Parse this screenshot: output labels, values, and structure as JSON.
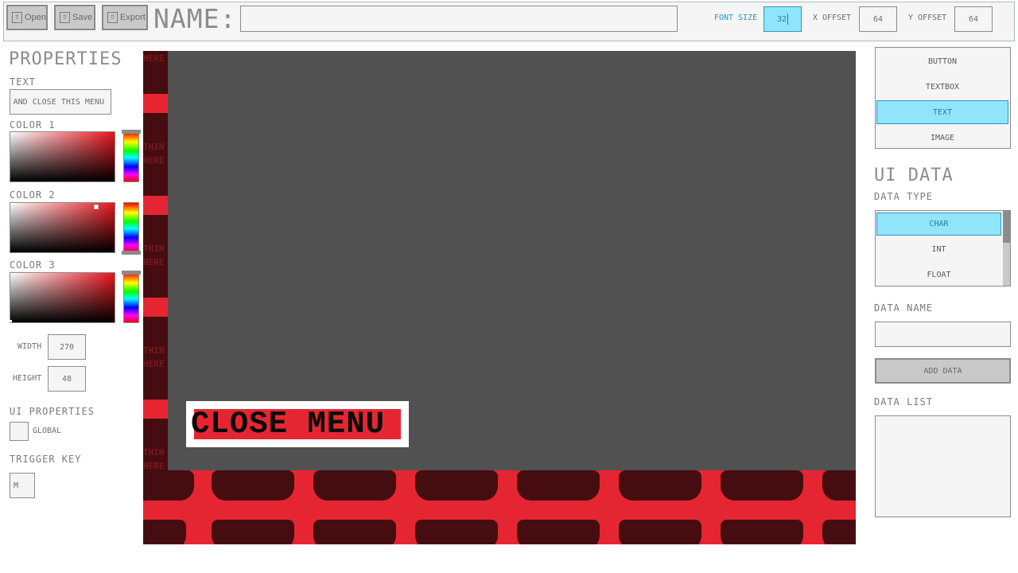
{
  "toolbar": {
    "open_label": "Open",
    "save_label": "Save",
    "export_label": "Export",
    "name_label": "NAME:",
    "name_value": "",
    "font_size_label": "FONT SIZE",
    "font_size_value": "32",
    "x_offset_label": "X OFFSET",
    "x_offset_value": "64",
    "y_offset_label": "Y OFFSET",
    "y_offset_value": "64"
  },
  "properties": {
    "title": "PROPERTIES",
    "text_label": "TEXT",
    "text_value": "AND CLOSE THIS MENU",
    "color1_label": "COLOR 1",
    "color2_label": "COLOR 2",
    "color3_label": "COLOR 3",
    "picker_hue": "#e8141c",
    "width_label": "WIDTH",
    "width_value": "270",
    "height_label": "HEIGHT",
    "height_value": "48",
    "ui_properties_label": "UI PROPERTIES",
    "global_label": "GLOBAL",
    "global_checked": false,
    "trigger_key_label": "TRIGGER KEY",
    "trigger_key_value": "M"
  },
  "canvas": {
    "bg_text_top": "HERE",
    "bg_text_1": "THIN",
    "bg_text_2": "HERE",
    "element_text": "CLOSE MENU",
    "accent_red": "#e52632",
    "dark_red": "#450d10",
    "gray": "#515151"
  },
  "element_types": {
    "items": [
      "BUTTON",
      "TEXTBOX",
      "TEXT",
      "IMAGE"
    ],
    "selected": "TEXT"
  },
  "ui_data": {
    "title": "UI DATA",
    "data_type_label": "DATA TYPE",
    "data_types": [
      "CHAR",
      "INT",
      "FLOAT"
    ],
    "selected_type": "CHAR",
    "data_name_label": "DATA NAME",
    "data_name_value": "",
    "add_data_label": "ADD DATA",
    "data_list_label": "DATA LIST"
  },
  "theme": {
    "selection_fill": "#90e5fb",
    "selection_border": "#2c97c5"
  }
}
